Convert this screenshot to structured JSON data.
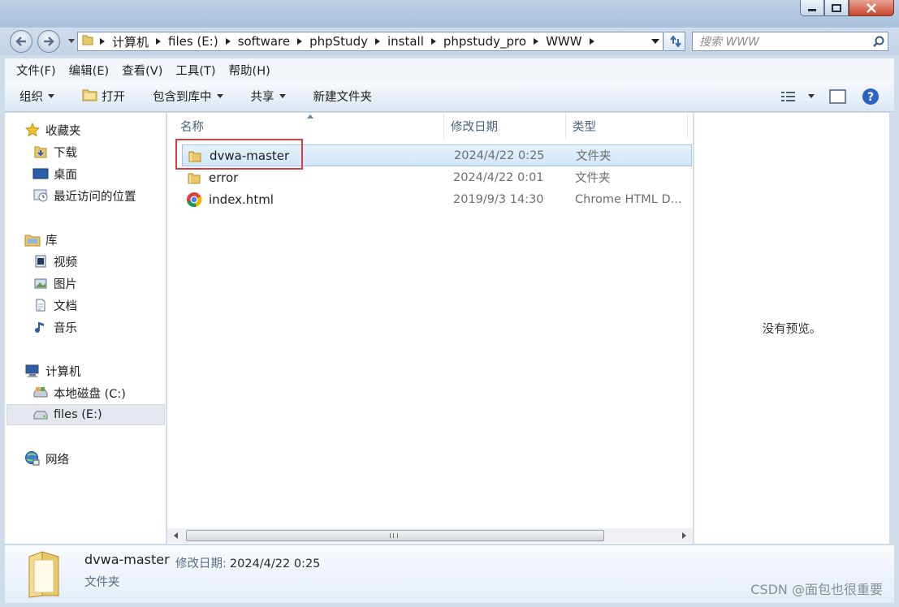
{
  "address": {
    "crumbs": [
      "计算机",
      "files (E:)",
      "software",
      "phpStudy",
      "install",
      "phpstudy_pro",
      "WWW"
    ]
  },
  "search": {
    "placeholder": "搜索 WWW"
  },
  "menu": [
    "文件(F)",
    "编辑(E)",
    "查看(V)",
    "工具(T)",
    "帮助(H)"
  ],
  "toolbar": {
    "organize": "组织",
    "open": "打开",
    "include_library": "包含到库中",
    "share": "共享",
    "new_folder": "新建文件夹"
  },
  "nav": {
    "favorites": "收藏夹",
    "downloads": "下载",
    "desktop": "桌面",
    "recent": "最近访问的位置",
    "libraries": "库",
    "videos": "视频",
    "pictures": "图片",
    "documents": "文档",
    "music": "音乐",
    "computer": "计算机",
    "drive_c": "本地磁盘 (C:)",
    "drive_e": "files (E:)",
    "network": "网络"
  },
  "columns": {
    "name": "名称",
    "date": "修改日期",
    "type": "类型"
  },
  "files": [
    {
      "name": "dvwa-master",
      "date": "2024/4/22 0:25",
      "type": "文件夹",
      "icon": "folder-icon",
      "selected": true
    },
    {
      "name": "error",
      "date": "2024/4/22 0:01",
      "type": "文件夹",
      "icon": "folder-icon",
      "selected": false
    },
    {
      "name": "index.html",
      "date": "2019/9/3 14:30",
      "type": "Chrome HTML D...",
      "icon": "chrome-icon",
      "selected": false
    }
  ],
  "preview": {
    "empty_text": "没有预览。"
  },
  "details": {
    "name": "dvwa-master",
    "date_label": "修改日期:",
    "date_value": "2024/4/22 0:25",
    "type": "文件夹"
  },
  "watermark": "CSDN @面包也很重要",
  "colors": {
    "selection": "#cce4f7",
    "highlight_box": "#e03a3a",
    "window_frame": "#bcd0e6"
  }
}
